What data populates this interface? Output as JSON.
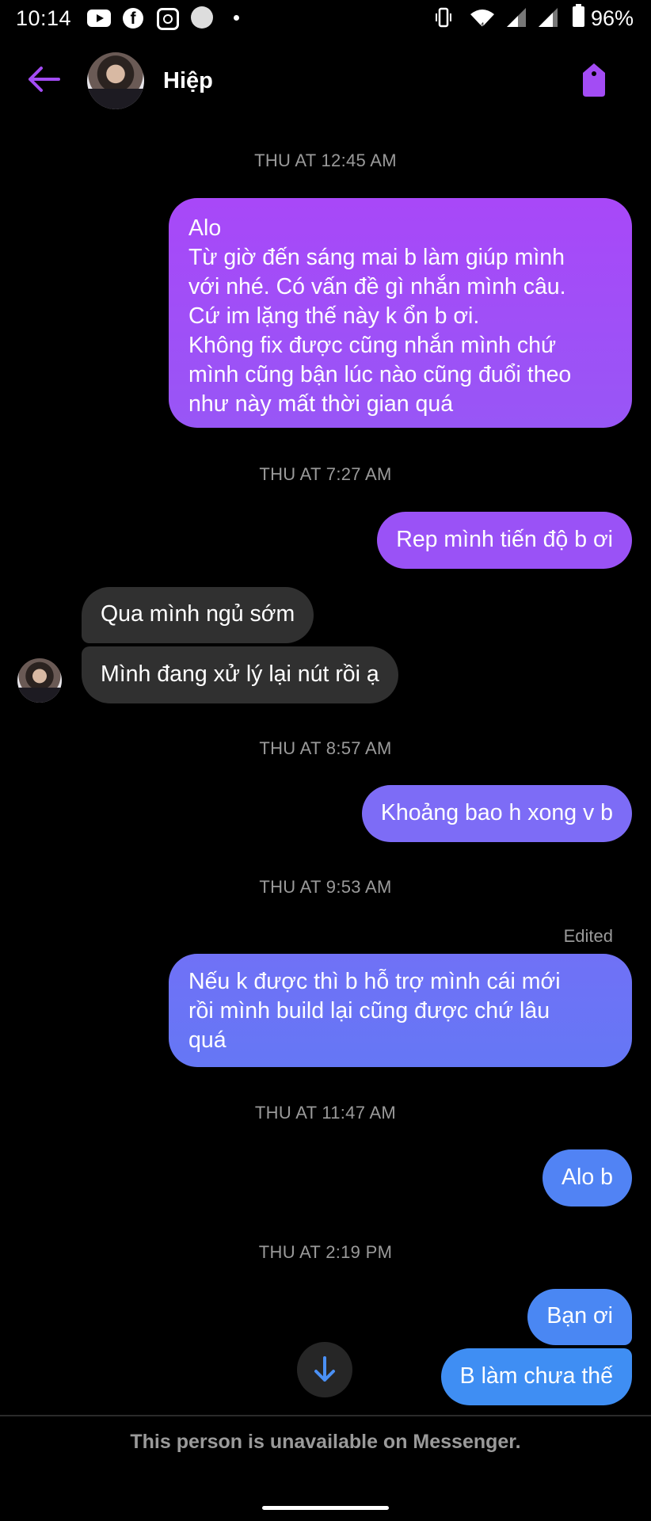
{
  "status_bar": {
    "time": "10:14",
    "battery": "96%",
    "icons": [
      "youtube-icon",
      "facebook-icon",
      "instagram-icon",
      "circle-icon",
      "dot-icon",
      "vibrate-icon",
      "wifi-icon",
      "signal-icon",
      "signal-icon",
      "battery-icon"
    ]
  },
  "header": {
    "contact_name": "Hiệp",
    "back_icon": "arrow-left-icon",
    "action_icon": "tag-icon",
    "accent_color": "#a34cf4"
  },
  "conversation": {
    "groups": [
      {
        "timestamp": "THU AT 12:45 AM",
        "messages": [
          {
            "direction": "outgoing",
            "lines": [
              "Alo",
              "Từ giờ đến sáng mai b làm giúp mình",
              "với nhé. Có vấn đề gì nhắn mình câu.",
              "Cứ im lặng thế này k ổn b ơi.",
              "Không fix được cũng nhắn mình chứ",
              "mình cũng bận lúc nào cũng đuổi theo",
              "như này mất thời gian quá"
            ]
          }
        ]
      },
      {
        "timestamp": "THU AT 7:27 AM",
        "messages": [
          {
            "direction": "outgoing",
            "lines": [
              "Rep mình tiến độ b ơi"
            ]
          },
          {
            "direction": "incoming",
            "lines": [
              "Qua mình ngủ sớm"
            ]
          },
          {
            "direction": "incoming",
            "lines": [
              "Mình đang xử lý lại nút rồi ạ"
            ]
          }
        ]
      },
      {
        "timestamp": "THU AT 8:57 AM",
        "messages": [
          {
            "direction": "outgoing",
            "lines": [
              "Khoảng bao h xong v b"
            ]
          }
        ]
      },
      {
        "timestamp": "THU AT 9:53 AM",
        "messages": [
          {
            "direction": "outgoing",
            "edited_label": "Edited",
            "lines": [
              "Nếu k được thì b hỗ trợ mình cái mới",
              "rồi mình build lại cũng được chứ lâu",
              "quá"
            ]
          }
        ]
      },
      {
        "timestamp": "THU AT 11:47 AM",
        "messages": [
          {
            "direction": "outgoing",
            "lines": [
              "Alo b"
            ]
          }
        ]
      },
      {
        "timestamp": "THU AT 2:19 PM",
        "messages": [
          {
            "direction": "outgoing",
            "lines": [
              "Bạn ơi"
            ]
          },
          {
            "direction": "outgoing",
            "lines": [
              "B làm chưa thế"
            ]
          }
        ]
      }
    ]
  },
  "scroll_down_icon": "arrow-down-icon",
  "footer": {
    "notice": "This person is unavailable on Messenger."
  },
  "colors": {
    "background": "#000000",
    "incoming_bubble": "#303030",
    "outgoing_gradient_top": "#a848f8",
    "outgoing_gradient_bottom": "#3f90f3",
    "timestamp_text": "#9a9a9a"
  }
}
